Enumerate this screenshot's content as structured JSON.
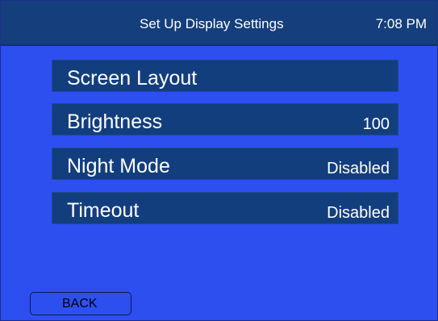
{
  "header": {
    "title": "Set Up Display Settings",
    "time": "7:08 PM"
  },
  "menu": {
    "items": [
      {
        "label": "Screen Layout",
        "value": ""
      },
      {
        "label": "Brightness",
        "value": "100"
      },
      {
        "label": "Night Mode",
        "value": "Disabled"
      },
      {
        "label": "Timeout",
        "value": "Disabled"
      }
    ]
  },
  "footer": {
    "back_label": "BACK"
  },
  "colors": {
    "background": "#2d4ff0",
    "header": "#143e7c",
    "item": "#133e7e",
    "text": "#ffffff"
  }
}
